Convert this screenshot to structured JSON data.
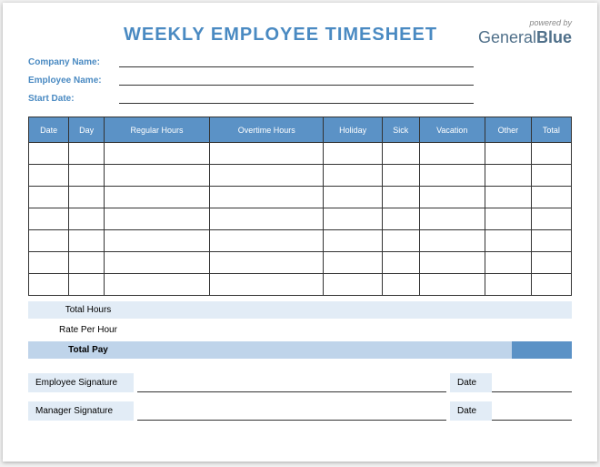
{
  "title": "WEEKLY EMPLOYEE TIMESHEET",
  "brand": {
    "powered_by": "powered by",
    "general": "General",
    "blue": "Blue"
  },
  "info": {
    "company_name_label": "Company Name:",
    "employee_name_label": "Employee Name:",
    "start_date_label": "Start Date:"
  },
  "columns": [
    "Date",
    "Day",
    "Regular Hours",
    "Overtime Hours",
    "Holiday",
    "Sick",
    "Vacation",
    "Other",
    "Total"
  ],
  "rows": [
    {},
    {},
    {},
    {},
    {},
    {},
    {}
  ],
  "summary": {
    "total_hours": "Total Hours",
    "rate_per_hour": "Rate Per Hour",
    "total_pay": "Total Pay"
  },
  "signatures": {
    "employee": "Employee Signature",
    "manager": "Manager Signature",
    "date": "Date"
  }
}
